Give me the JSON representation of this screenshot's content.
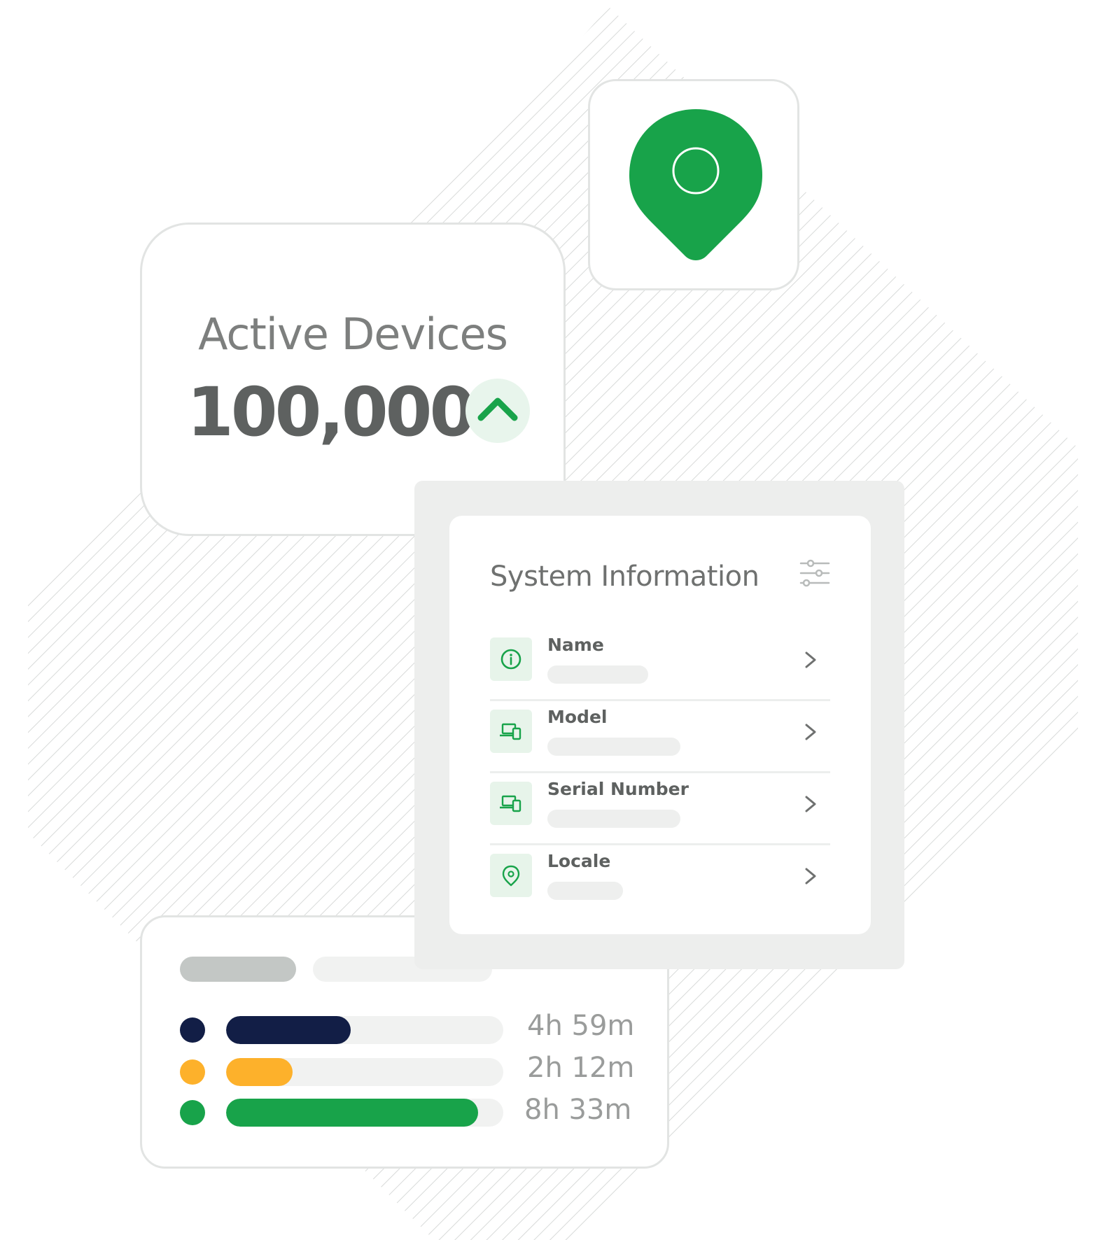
{
  "colors": {
    "brand_green": "#18a34a",
    "navy": "#121e46",
    "amber": "#fdb12b",
    "text_gray": "#5e6160",
    "skeleton_gray": "#eeefee"
  },
  "active_devices": {
    "title": "Active Devices",
    "value": "100,000",
    "trend_icon": "chevron-up-icon"
  },
  "location_tile": {
    "icon": "map-pin-icon"
  },
  "system_info": {
    "title": "System Information",
    "filter_icon": "sliders-icon",
    "rows": [
      {
        "label": "Name",
        "icon": "info-icon"
      },
      {
        "label": "Model",
        "icon": "devices-icon"
      },
      {
        "label": "Serial Number",
        "icon": "devices-icon"
      },
      {
        "label": "Locale",
        "icon": "map-pin-icon"
      }
    ]
  },
  "usage": {
    "rows": [
      {
        "color": "#121e46",
        "progress": 0.45,
        "time": "4h 59m"
      },
      {
        "color": "#fdb12b",
        "progress": 0.24,
        "time": "2h 12m"
      },
      {
        "color": "#18a34a",
        "progress": 0.91,
        "time": "8h 33m"
      }
    ]
  }
}
